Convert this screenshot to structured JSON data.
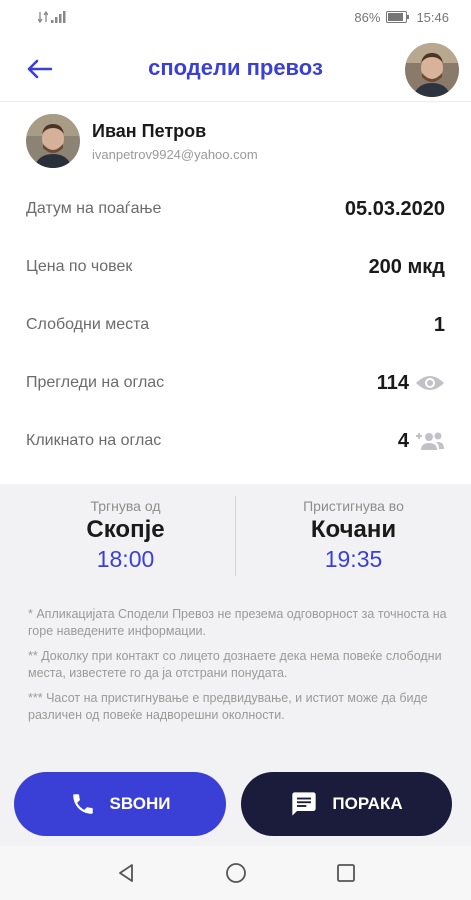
{
  "status_bar": {
    "battery": "86%",
    "time": "15:46"
  },
  "header": {
    "title": "сподели превоз"
  },
  "profile": {
    "name": "Иван Петров",
    "email": "ivanpetrov9924@yahoo.com"
  },
  "details": [
    {
      "label": "Датум на поаѓање",
      "value": "05.03.2020"
    },
    {
      "label": "Цена по човек",
      "value": "200 мкд"
    },
    {
      "label": "Слободни места",
      "value": "1"
    },
    {
      "label": "Прегледи на оглас",
      "value": "114",
      "icon": "eye-icon"
    },
    {
      "label": "Кликнато на оглас",
      "value": "4",
      "icon": "group-add-icon"
    }
  ],
  "route": {
    "from_label": "Тргнува од",
    "from_city": "Скопје",
    "from_time": "18:00",
    "to_label": "Пристигнува во",
    "to_city": "Кочани",
    "to_time": "19:35"
  },
  "notes": [
    "* Апликацијата Сподели Превоз не презема одговорност за точноста на горе наведените информации.",
    "** Доколку при контакт со лицето дознаете дека нема повеќе слободни места, известете го да ја отстрани понудата.",
    "*** Часот на пристигнување е предвидувањe, и истиот може да биде различен од повеќе надворешни околности."
  ],
  "actions": {
    "call_label": "SВОНИ",
    "message_label": "ПОРАКА"
  },
  "colors": {
    "accent": "#3a3fd6",
    "dark": "#1b1c3c",
    "panel": "#f2f2f4"
  }
}
